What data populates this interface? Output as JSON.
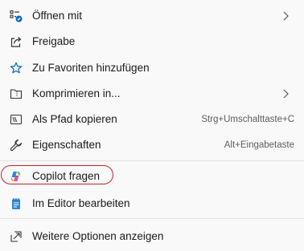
{
  "menu": {
    "items": [
      {
        "label": "Öffnen mit",
        "icon": "open-with-icon",
        "submenu": true
      },
      {
        "label": "Freigabe",
        "icon": "share-icon"
      },
      {
        "label": "Zu Favoriten hinzufügen",
        "icon": "star-icon"
      },
      {
        "label": "Komprimieren in...",
        "icon": "compress-folder-icon",
        "submenu": true
      },
      {
        "label": "Als Pfad kopieren",
        "icon": "copy-path-icon",
        "shortcut": "Strg+Umschalttaste+C"
      },
      {
        "label": "Eigenschaften",
        "icon": "wrench-icon",
        "shortcut": "Alt+Eingabetaste"
      },
      {
        "label": "Copilot fragen",
        "icon": "copilot-icon",
        "highlighted": true
      },
      {
        "label": "Im Editor bearbeiten",
        "icon": "notepad-icon"
      },
      {
        "label": "Weitere Optionen anzeigen",
        "icon": "more-options-icon"
      }
    ]
  },
  "colors": {
    "accent": "#0067c0",
    "highlight_ring": "#c0252a",
    "background": "#f9f9f9"
  }
}
